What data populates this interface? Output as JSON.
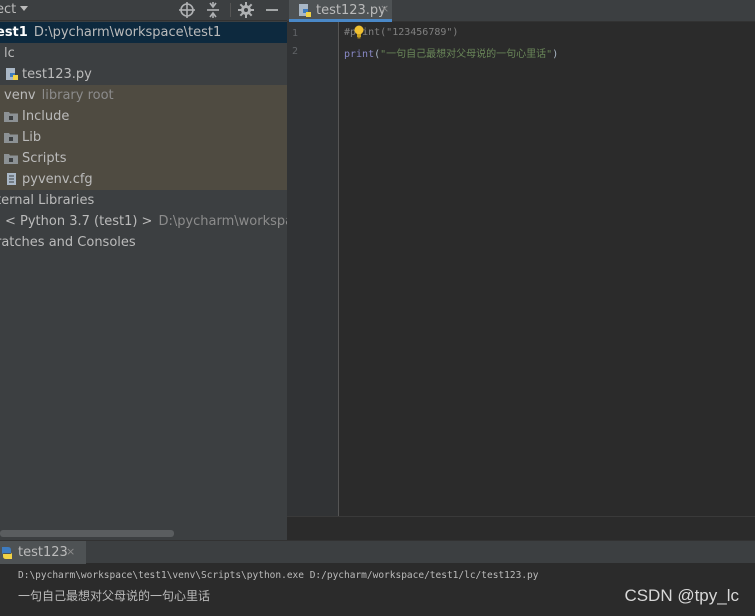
{
  "project_panel": {
    "title": "ect",
    "tree": [
      {
        "label": "est1",
        "suffix": "D:\\pycharm\\workspace\\test1",
        "icon": "project-folder-icon"
      },
      {
        "label": "lc",
        "icon": ""
      },
      {
        "label": "test123.py",
        "icon": "python-file-icon"
      },
      {
        "label": "venv",
        "suffix": "library root",
        "icon": ""
      },
      {
        "label": "Include",
        "icon": "folder-icon"
      },
      {
        "label": "Lib",
        "icon": "folder-icon"
      },
      {
        "label": "Scripts",
        "icon": "folder-icon"
      },
      {
        "label": "pyvenv.cfg",
        "icon": "config-file-icon"
      },
      {
        "label": "ternal Libraries",
        "icon": ""
      },
      {
        "label": "< Python 3.7 (test1) >",
        "suffix": "D:\\pycharm\\workspace\\te",
        "icon": ""
      },
      {
        "label": "ratches and Consoles",
        "icon": ""
      }
    ]
  },
  "editor": {
    "tab_label": "test123.py",
    "tab_close": "×",
    "line_numbers": [
      "1",
      "2"
    ],
    "lines": [
      {
        "comment_prefix": "#",
        "keyword": "print",
        "open": "(",
        "string": "\"123456789\"",
        "close": ")"
      },
      {
        "keyword": "print",
        "open": "(",
        "string": "\"一句自己最想对父母说的一句心里话\"",
        "close": ")"
      }
    ]
  },
  "run_panel": {
    "tab_label": "test123",
    "tab_close": "×",
    "command": "D:\\pycharm\\workspace\\test1\\venv\\Scripts\\python.exe D:/pycharm/workspace/test1/lc/test123.py",
    "output": "一句自己最想对父母说的一句心里话"
  },
  "watermark": "CSDN @tpy_lc",
  "colors": {
    "panel_bg": "#3c3f41",
    "editor_bg": "#2b2b2b",
    "selection": "#0d293e",
    "excluded": "#4f4b41",
    "keyword": "#8888c6",
    "string": "#6a8759",
    "comment": "#808080"
  }
}
